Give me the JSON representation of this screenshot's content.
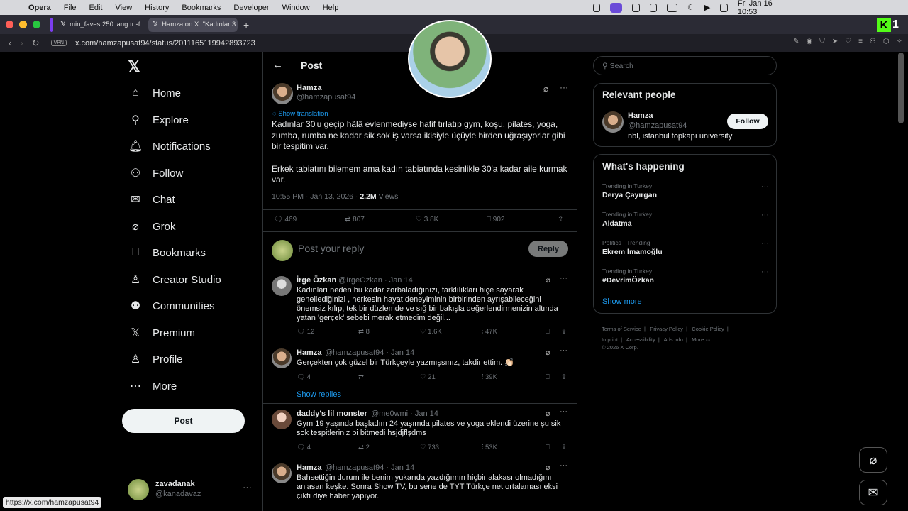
{
  "menubar": {
    "app": "Opera",
    "items": [
      "File",
      "Edit",
      "View",
      "History",
      "Bookmarks",
      "Developer",
      "Window",
      "Help"
    ],
    "datetime": "Fri Jan 16  10:53"
  },
  "tabs": [
    {
      "label": "min_faves:250 lang:tr -f"
    },
    {
      "label": "Hamza on X: \"Kadınlar 3"
    }
  ],
  "address": {
    "url": "x.com/hamzapusat94/status/2011165119942893723",
    "vpn": "VPN"
  },
  "nav": {
    "items": [
      {
        "label": "Home",
        "icon": "home-icon"
      },
      {
        "label": "Explore",
        "icon": "search-icon"
      },
      {
        "label": "Notifications",
        "icon": "bell-icon"
      },
      {
        "label": "Follow",
        "icon": "add-person-icon"
      },
      {
        "label": "Chat",
        "icon": "mail-icon"
      },
      {
        "label": "Grok",
        "icon": "grok-icon"
      },
      {
        "label": "Bookmarks",
        "icon": "bookmark-icon"
      },
      {
        "label": "Creator Studio",
        "icon": "studio-icon"
      },
      {
        "label": "Communities",
        "icon": "communities-icon"
      },
      {
        "label": "Premium",
        "icon": "x-icon"
      },
      {
        "label": "Profile",
        "icon": "person-icon"
      },
      {
        "label": "More",
        "icon": "more-icon"
      }
    ],
    "post_label": "Post"
  },
  "account": {
    "name": "zavadanak",
    "handle": "@kanadavaz"
  },
  "status_url": "https://x.com/hamzapusat94",
  "post": {
    "header": "Post",
    "name": "Hamza",
    "handle": "@hamzapusat94",
    "show_translation": "Show translation",
    "text1": "Kadınlar 30'u geçip hâlâ evlenmediyse hafif tırlatıp gym, koşu, pilates, yoga, zumba, rumba ne kadar sik sok iş varsa ikisiyle üçüyle birden uğraşıyorlar gibi bir tespitim var.",
    "text2": "Erkek tabiatını bilemem ama kadın tabiatında kesinlikle 30'a kadar aile kurmak var.",
    "time": "10:55 PM · Jan 13, 2026 · ",
    "views_count": "2.2M",
    "views_label": " Views",
    "replies": "469",
    "reposts": "807",
    "likes": "3.8K",
    "bookmarks": "902",
    "reply_placeholder": "Post your reply",
    "reply_button": "Reply"
  },
  "replies": [
    {
      "name": "İrge Özkan",
      "meta": "@IrgeOzkan · Jan 14",
      "text": "Kadınları neden bu kadar zorbaladığınızı, farklılıkları hiçe sayarak genellediğinizi , herkesin hayat deneyiminin birbirinden ayrışabileceğini önemsiz kılıp, tek bir düzlemde ve sığ bir bakışla değerlendirmenizin altında yatan 'gerçek' sebebi merak etmedim değil...",
      "replies": "12",
      "reposts": "8",
      "likes": "1.6K",
      "views": "47K"
    },
    {
      "name": "Hamza",
      "meta": "@hamzapusat94 · Jan 14",
      "text": "Gerçekten çok güzel bir Türkçeyle yazmışsınız, takdir ettim. 👏🏻",
      "replies": "4",
      "reposts": "",
      "likes": "21",
      "views": "39K",
      "show_replies": "Show replies"
    },
    {
      "name": "daddy's lil monster",
      "meta": "@me0wmi · Jan 14",
      "text": "Gym 19 yaşında başladım 24 yaşımda pilates ve yoga eklendi üzerine şu sik sok tespitleriniz bi bitmedi hsjdjflşdms",
      "replies": "4",
      "reposts": "2",
      "likes": "733",
      "views": "53K"
    },
    {
      "name": "Hamza",
      "meta": "@hamzapusat94 · Jan 14",
      "text": "Bahsettiğin durum ile benim yukarıda yazdığımın hiçbir alakası olmadığını anlasan keşke. Sonra Show TV, bu sene de TYT Türkçe net ortalaması eksi çıktı diye haber yapıyor."
    }
  ],
  "sidebar": {
    "search_placeholder": "Search",
    "relevant_title": "Relevant people",
    "person": {
      "name": "Hamza",
      "handle": "@hamzapusat94",
      "bio": "nbl, istanbul topkapı university",
      "follow": "Follow"
    },
    "happening_title": "What's happening",
    "trends": [
      {
        "meta": "Trending in Turkey",
        "name": "Derya Çayırgan"
      },
      {
        "meta": "Trending in Turkey",
        "name": "Aldatma"
      },
      {
        "meta": "Politics · Trending",
        "name": "Ekrem İmamoğlu"
      },
      {
        "meta": "Trending in Turkey",
        "name": "#DevrimÖzkan"
      }
    ],
    "show_more": "Show more",
    "footer": [
      "Terms of Service",
      "Privacy Policy",
      "Cookie Policy",
      "Imprint",
      "Accessibility",
      "Ads info",
      "More ···",
      "© 2026 X Corp."
    ]
  },
  "colors": {
    "accent": "#1d9bf0",
    "bg": "#000000",
    "border": "#2f3336"
  }
}
